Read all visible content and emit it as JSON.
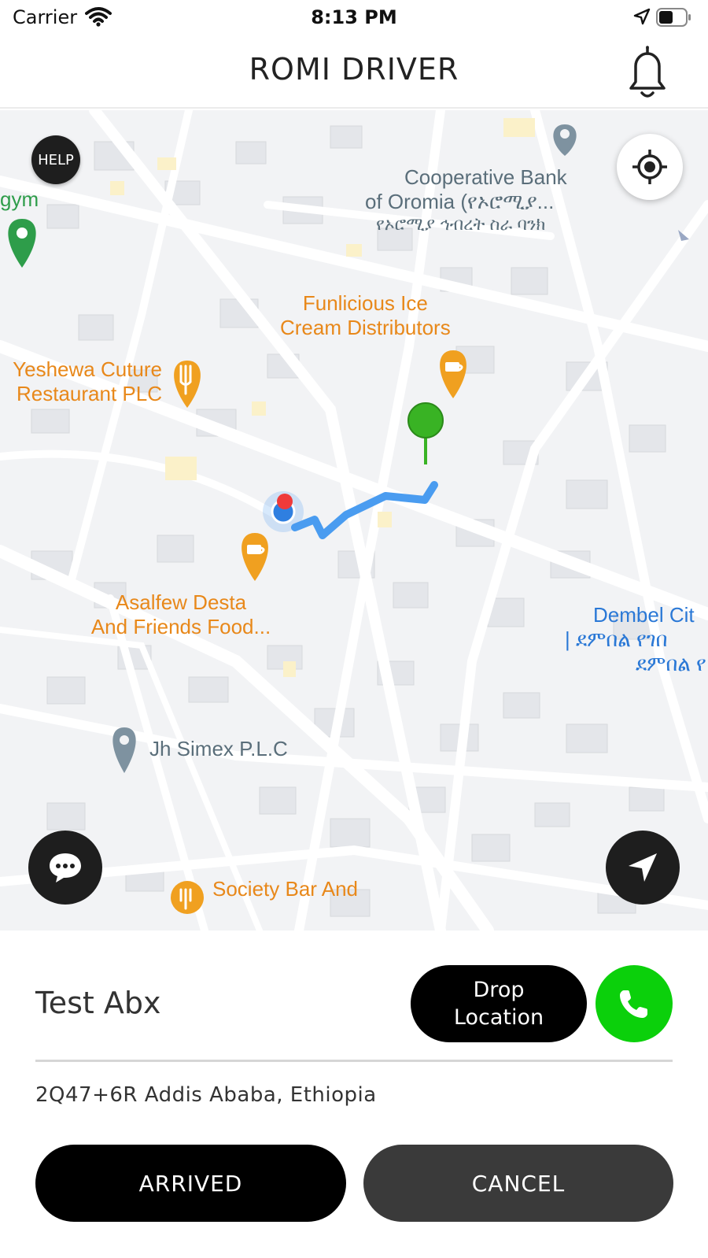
{
  "status_bar": {
    "carrier": "Carrier",
    "time": "8:13 PM"
  },
  "header": {
    "title": "ROMI DRIVER",
    "icons": [
      "bell-icon"
    ]
  },
  "map": {
    "help_label": "HELP",
    "pois": {
      "cooperative_bank_line1": "Cooperative Bank",
      "cooperative_bank_line2": "of Oromia (የኦሮሚያ...",
      "cooperative_bank_line3": "የኦሮሚያ ኅብረት ስራ ባንክ",
      "gym": "gym",
      "funlicious_line1": "Funlicious Ice",
      "funlicious_line2": "Cream Distributors",
      "yeshewa_line1": "Yeshewa Cuture",
      "yeshewa_line2": "Restaurant PLC",
      "asalfew_line1": "Asalfew Desta",
      "asalfew_line2": "And Friends Food...",
      "dembel_line1": "Dembel Cit",
      "dembel_line2": "| ደምበል የገበ",
      "dembel_line3": "ደምበል የ",
      "jh_simex": "Jh Simex P.L.C",
      "society_bar": "Society Bar And"
    },
    "icons": [
      "my-location-icon",
      "chat-icon",
      "navigate-icon",
      "pin-icon",
      "restaurant-icon",
      "cafe-icon"
    ],
    "colors": {
      "route": "#4a9cf0",
      "destination_pin": "#39b324",
      "poi_orange": "#f0a020"
    }
  },
  "trip": {
    "passenger_name": "Test Abx",
    "drop_location_label": "Drop Location",
    "pickup_address": "2Q47+6R Addis Ababa, Ethiopia",
    "arrived_label": "ARRIVED",
    "cancel_label": "CANCEL",
    "call_color": "#0bd00b"
  }
}
